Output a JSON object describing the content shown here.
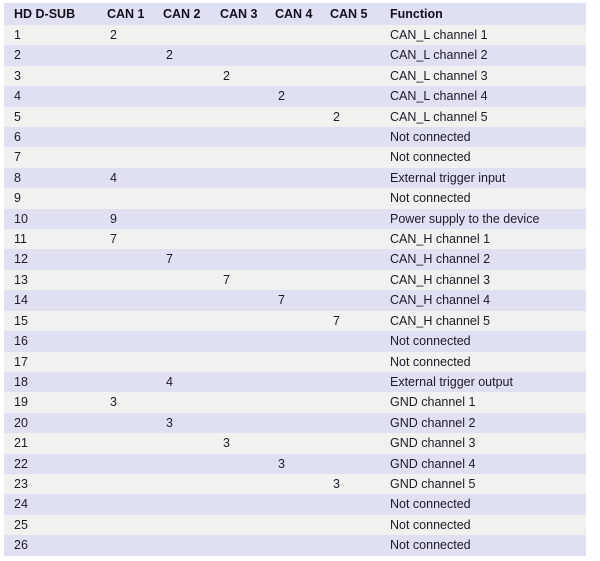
{
  "table": {
    "columns": [
      {
        "key": "pin",
        "label": "HD D-SUB"
      },
      {
        "key": "can1",
        "label": "CAN 1"
      },
      {
        "key": "can2",
        "label": "CAN 2"
      },
      {
        "key": "can3",
        "label": "CAN 3"
      },
      {
        "key": "can4",
        "label": "CAN 4"
      },
      {
        "key": "can5",
        "label": "CAN 5"
      },
      {
        "key": "function",
        "label": "Function"
      }
    ],
    "rows": [
      {
        "pin": "1",
        "can1": "2",
        "can2": "",
        "can3": "",
        "can4": "",
        "can5": "",
        "function": "CAN_L channel 1"
      },
      {
        "pin": "2",
        "can1": "",
        "can2": "2",
        "can3": "",
        "can4": "",
        "can5": "",
        "function": "CAN_L channel 2"
      },
      {
        "pin": "3",
        "can1": "",
        "can2": "",
        "can3": "2",
        "can4": "",
        "can5": "",
        "function": "CAN_L channel 3"
      },
      {
        "pin": "4",
        "can1": "",
        "can2": "",
        "can3": "",
        "can4": "2",
        "can5": "",
        "function": "CAN_L channel 4"
      },
      {
        "pin": "5",
        "can1": "",
        "can2": "",
        "can3": "",
        "can4": "",
        "can5": "2",
        "function": "CAN_L channel 5"
      },
      {
        "pin": "6",
        "can1": "",
        "can2": "",
        "can3": "",
        "can4": "",
        "can5": "",
        "function": "Not connected"
      },
      {
        "pin": "7",
        "can1": "",
        "can2": "",
        "can3": "",
        "can4": "",
        "can5": "",
        "function": "Not connected"
      },
      {
        "pin": "8",
        "can1": "4",
        "can2": "",
        "can3": "",
        "can4": "",
        "can5": "",
        "function": "External trigger input"
      },
      {
        "pin": "9",
        "can1": "",
        "can2": "",
        "can3": "",
        "can4": "",
        "can5": "",
        "function": "Not connected"
      },
      {
        "pin": "10",
        "can1": "9",
        "can2": "",
        "can3": "",
        "can4": "",
        "can5": "",
        "function": "Power supply to the device"
      },
      {
        "pin": "11",
        "can1": "7",
        "can2": "",
        "can3": "",
        "can4": "",
        "can5": "",
        "function": "CAN_H channel 1"
      },
      {
        "pin": "12",
        "can1": "",
        "can2": "7",
        "can3": "",
        "can4": "",
        "can5": "",
        "function": "CAN_H channel 2"
      },
      {
        "pin": "13",
        "can1": "",
        "can2": "",
        "can3": "7",
        "can4": "",
        "can5": "",
        "function": "CAN_H channel 3"
      },
      {
        "pin": "14",
        "can1": "",
        "can2": "",
        "can3": "",
        "can4": "7",
        "can5": "",
        "function": "CAN_H channel 4"
      },
      {
        "pin": "15",
        "can1": "",
        "can2": "",
        "can3": "",
        "can4": "",
        "can5": "7",
        "function": "CAN_H channel 5"
      },
      {
        "pin": "16",
        "can1": "",
        "can2": "",
        "can3": "",
        "can4": "",
        "can5": "",
        "function": "Not connected"
      },
      {
        "pin": "17",
        "can1": "",
        "can2": "",
        "can3": "",
        "can4": "",
        "can5": "",
        "function": "Not connected"
      },
      {
        "pin": "18",
        "can1": "",
        "can2": "4",
        "can3": "",
        "can4": "",
        "can5": "",
        "function": "External trigger output"
      },
      {
        "pin": "19",
        "can1": "3",
        "can2": "",
        "can3": "",
        "can4": "",
        "can5": "",
        "function": "GND channel 1"
      },
      {
        "pin": "20",
        "can1": "",
        "can2": "3",
        "can3": "",
        "can4": "",
        "can5": "",
        "function": "GND channel 2"
      },
      {
        "pin": "21",
        "can1": "",
        "can2": "",
        "can3": "3",
        "can4": "",
        "can5": "",
        "function": "GND channel 3"
      },
      {
        "pin": "22",
        "can1": "",
        "can2": "",
        "can3": "",
        "can4": "3",
        "can5": "",
        "function": "GND channel 4"
      },
      {
        "pin": "23",
        "can1": "",
        "can2": "",
        "can3": "",
        "can4": "",
        "can5": "3",
        "function": "GND channel 5"
      },
      {
        "pin": "24",
        "can1": "",
        "can2": "",
        "can3": "",
        "can4": "",
        "can5": "",
        "function": "Not connected"
      },
      {
        "pin": "25",
        "can1": "",
        "can2": "",
        "can3": "",
        "can4": "",
        "can5": "",
        "function": "Not connected"
      },
      {
        "pin": "26",
        "can1": "",
        "can2": "",
        "can3": "",
        "can4": "",
        "can5": "",
        "function": "Not connected"
      }
    ]
  },
  "colors": {
    "header_bg": "#dfe0f2",
    "row_odd_bg": "#f1f1f0",
    "row_even_bg": "#dfe0f2",
    "text": "#1c1c26",
    "page_bg": "#ffffff"
  }
}
